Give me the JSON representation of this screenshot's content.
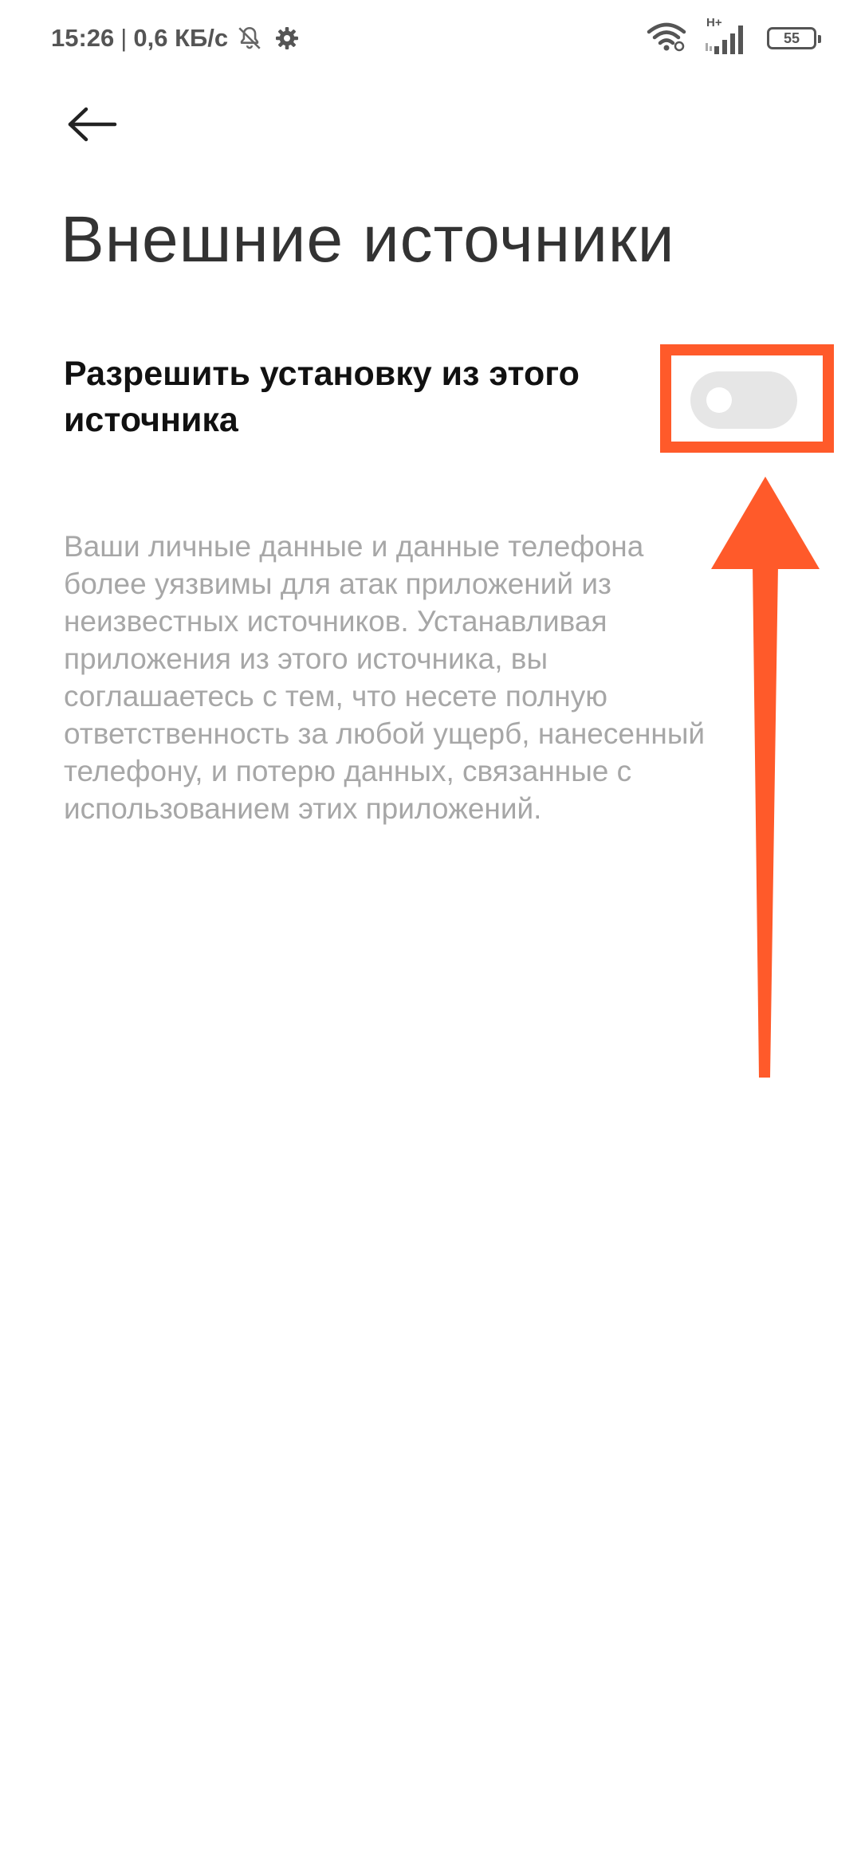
{
  "status_bar": {
    "time": "15:26",
    "separator": "|",
    "net_speed": "0,6 КБ/с",
    "network_type": "H+",
    "battery": "55",
    "icons": [
      "bell-off-icon",
      "gear-icon",
      "wifi-icon",
      "signal-icon",
      "battery-icon"
    ]
  },
  "header": {
    "back_icon": "arrow-left-icon",
    "title": "Внешние источники"
  },
  "setting": {
    "label": "Разрешить установку из этого источника",
    "toggle_state": "off"
  },
  "description": "Ваши личные данные и данные телефона более уязвимы для атак приложений из неизвестных источников. Устанавливая приложения из этого источника, вы соглашаетесь с тем, что несете полную ответственность за любой ущерб, нанесенный телефону, и потерю данных, связанные с использованием этих приложений.",
  "annotation": {
    "color": "#ff5a2a",
    "arrow_icon": "arrow-up-icon"
  },
  "colors": {
    "background": "#ffffff",
    "title": "#333333",
    "label": "#111111",
    "description": "#a7a7a7",
    "toggle_track": "#e6e6e6"
  }
}
